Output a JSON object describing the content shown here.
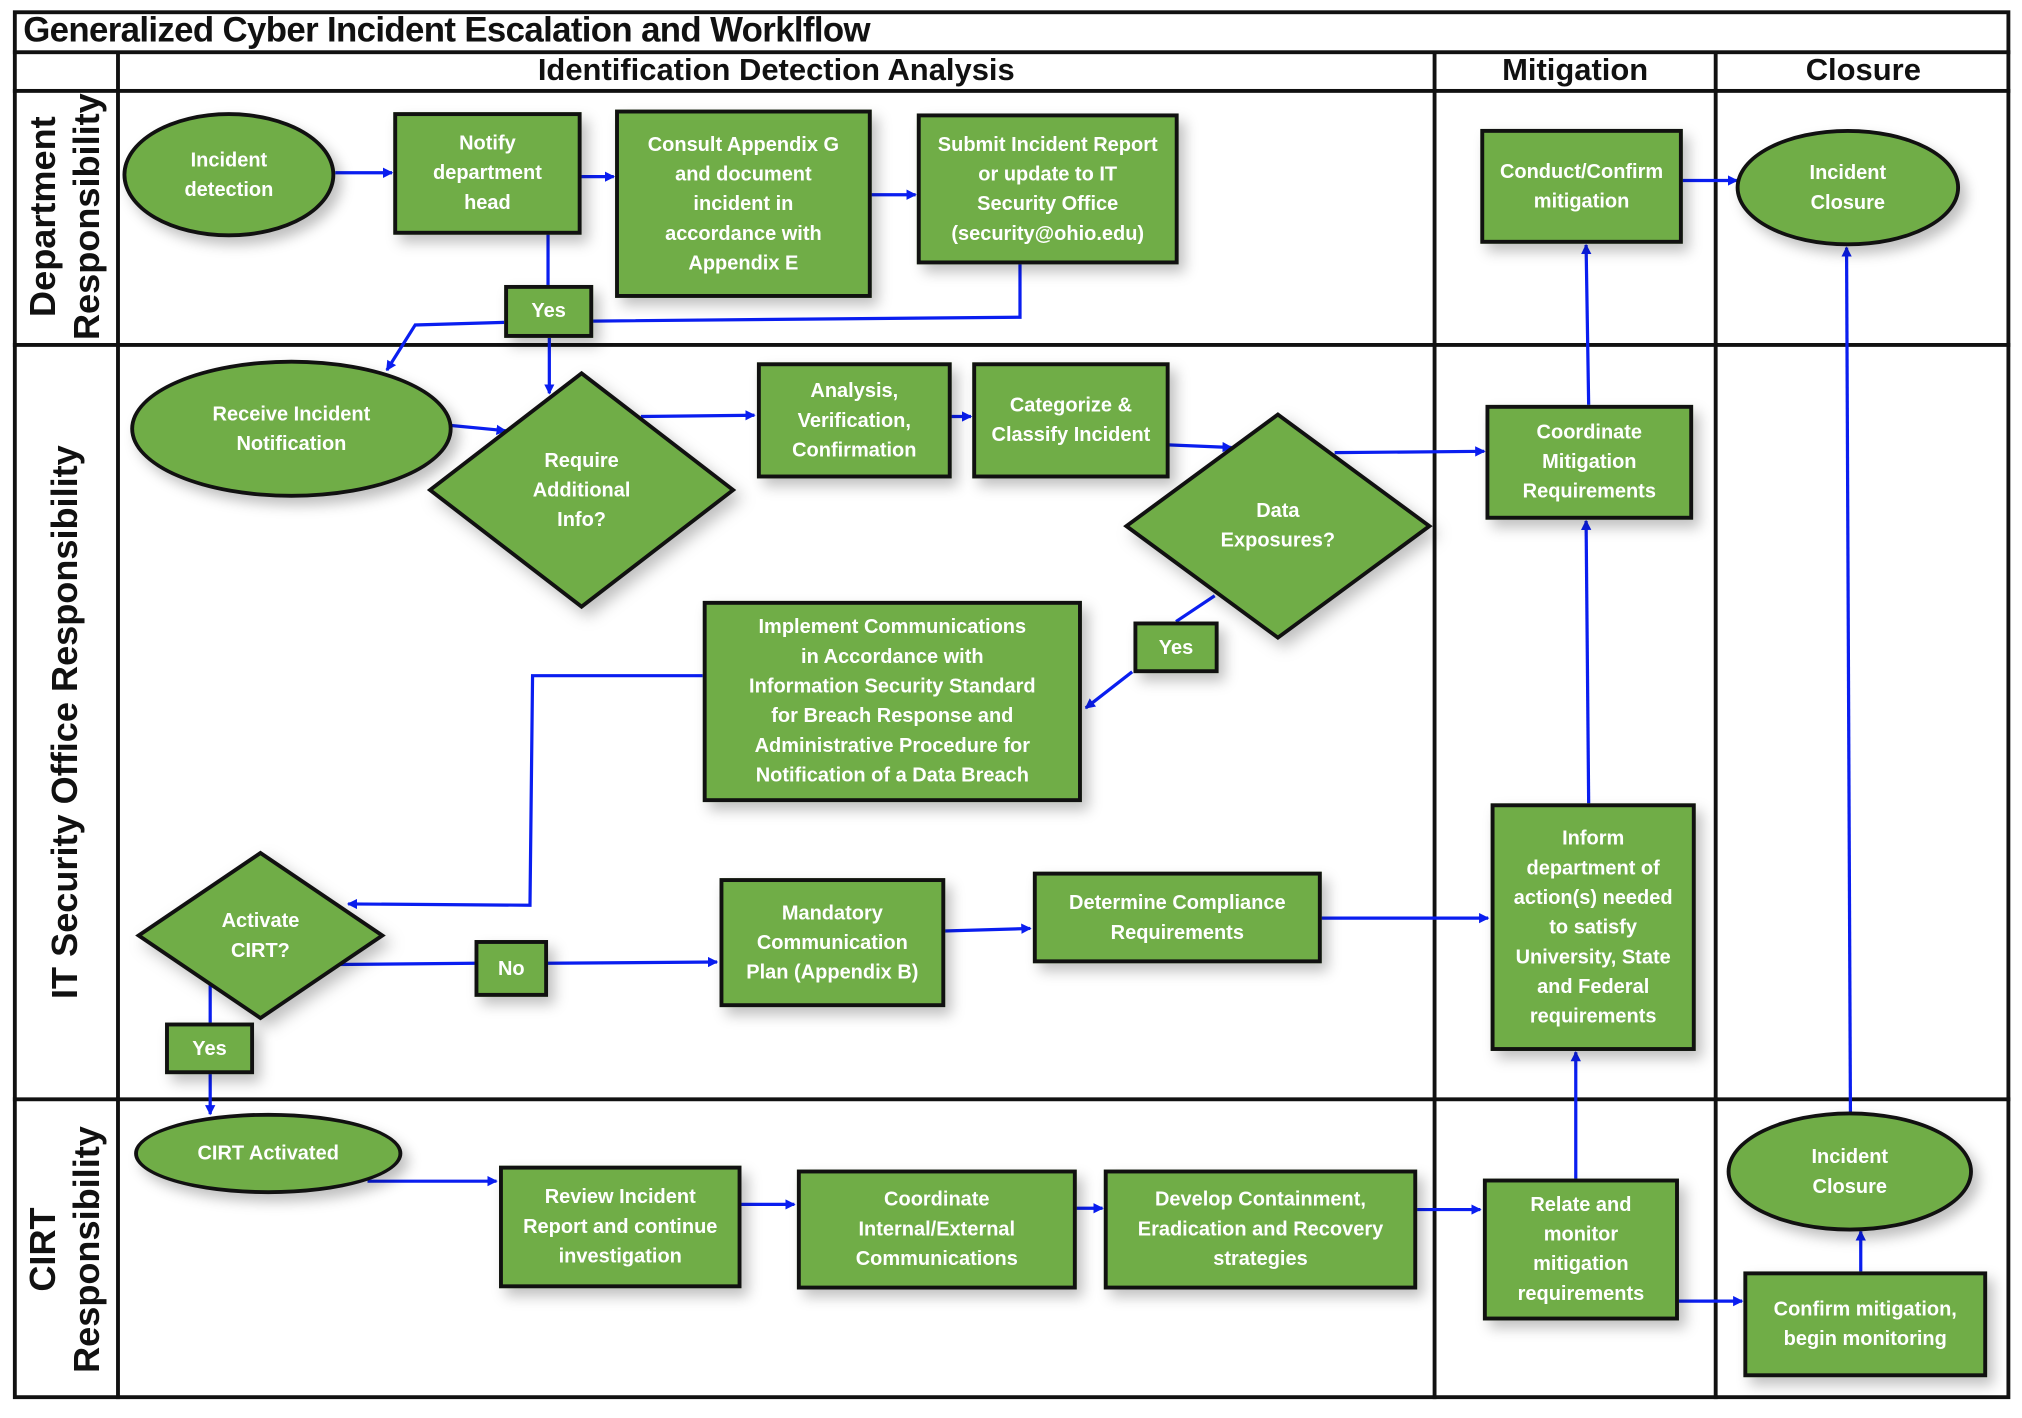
{
  "title": "Generalized Cyber Incident Escalation and Worklflow",
  "columns": {
    "identification": "Identification Detection Analysis",
    "mitigation": "Mitigation",
    "closure": "Closure"
  },
  "rows": {
    "department": "Department\nResponsibility",
    "it_security": "IT Security Office Responsibility",
    "cirt": "CIRT\nResponsibility"
  },
  "colors": {
    "node_fill": "#70ad47",
    "arrow": "#0a1ef0",
    "border": "#111111"
  },
  "nodes": {
    "incident_detection": "Incident\ndetection",
    "notify_head": "Notify\ndepartment\nhead",
    "consult_appendix": "Consult Appendix G\nand document\nincident in\naccordance with\nAppendix E",
    "submit_report": "Submit Incident Report\nor update to IT\nSecurity Office\n(security@ohio.edu)",
    "yes_dept": "Yes",
    "conduct_mitigation": "Conduct/Confirm\nmitigation",
    "incident_closure_top": "Incident\nClosure",
    "receive_notification": "Receive Incident\nNotification",
    "require_info": "Require\nAdditional\nInfo?",
    "analysis": "Analysis,\nVerification,\nConfirmation",
    "categorize": "Categorize &\nClassify Incident",
    "data_exposures": "Data\nExposures?",
    "coordinate_mitigation": "Coordinate\nMitigation\nRequirements",
    "yes_data": "Yes",
    "implement_comms": "Implement Communications\nin Accordance with\nInformation Security Standard\nfor Breach Response and\nAdministrative Procedure for\nNotification of a Data Breach",
    "activate_cirt": "Activate\nCIRT?",
    "no_cirt": "No",
    "mandatory_comm": "Mandatory\nCommunication\nPlan (Appendix B)",
    "determine_compliance": "Determine Compliance\nRequirements",
    "inform_department": "Inform\ndepartment of\naction(s) needed\nto satisfy\nUniversity, State\nand Federal\nrequirements",
    "yes_cirt": "Yes",
    "cirt_activated": "CIRT Activated",
    "review_report": "Review Incident\nReport and continue\ninvestigation",
    "coordinate_comms": "Coordinate\nInternal/External\nCommunications",
    "develop_containment": "Develop Containment,\nEradication and Recovery\nstrategies",
    "relate_monitor": "Relate and\nmonitor\nmitigation\nrequirements",
    "incident_closure_bottom": "Incident\nClosure",
    "confirm_monitoring": "Confirm mitigation,\nbegin monitoring"
  }
}
